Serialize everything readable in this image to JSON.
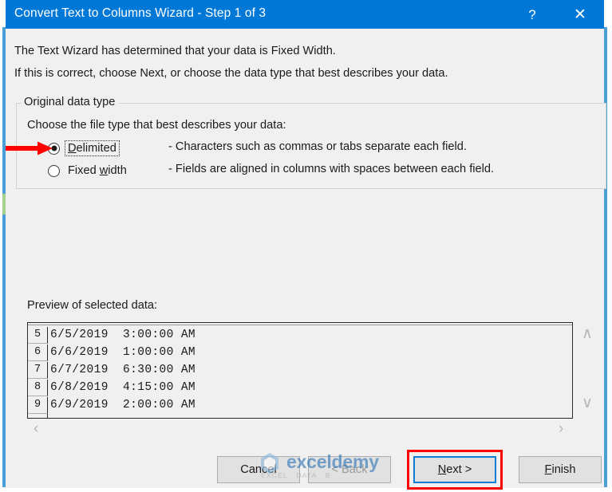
{
  "window": {
    "title": "Convert Text to Columns Wizard - Step 1 of 3",
    "help_icon": "?",
    "close_icon": "✕",
    "titlebar_color": "#0078d7"
  },
  "body": {
    "intro_line_1": "The Text Wizard has determined that your data is Fixed Width.",
    "intro_line_2": "If this is correct, choose Next, or choose the data type that best describes your data."
  },
  "original_data_type": {
    "group_label": "Original data type",
    "instruction": "Choose the file type that best describes your data:",
    "options": [
      {
        "label": "Delimited",
        "accelerator": "D",
        "description": "- Characters such as commas or tabs separate each field.",
        "selected": true,
        "focused": true
      },
      {
        "label": "Fixed width",
        "accelerator": "w",
        "description": "- Fields are aligned in columns with spaces between each field.",
        "selected": false,
        "focused": false
      }
    ]
  },
  "preview": {
    "label": "Preview of selected data:",
    "rows": [
      {
        "number": "5",
        "text": "6/5/2019  3:00:00 AM"
      },
      {
        "number": "6",
        "text": "6/6/2019  1:00:00 AM"
      },
      {
        "number": "7",
        "text": "6/7/2019  6:30:00 AM"
      },
      {
        "number": "8",
        "text": "6/8/2019  4:15:00 AM"
      },
      {
        "number": "9",
        "text": "6/9/2019  2:00:00 AM"
      }
    ],
    "scroll_up_icon": "∧",
    "scroll_down_icon": "∨",
    "scroll_left_icon": "‹",
    "scroll_right_icon": "›"
  },
  "footer": {
    "cancel_label": "Cancel",
    "back_label": "< Back",
    "back_disabled": true,
    "next_label_prefix": "",
    "next_accelerator": "N",
    "next_label_suffix": "ext >",
    "finish_accelerator": "F",
    "finish_label_suffix": "inish",
    "next_focused": true,
    "highlight_color": "#ff0000",
    "focus_color": "#0b7fd4"
  },
  "annotations": {
    "arrow_color": "#ff0000",
    "arrow_target": "Delimited radio button",
    "next_box_color": "#ff0000"
  },
  "watermark": {
    "brand": "exceldemy",
    "tagline": "EXCEL · DATA · B",
    "brand_color": "#2e75b6"
  }
}
